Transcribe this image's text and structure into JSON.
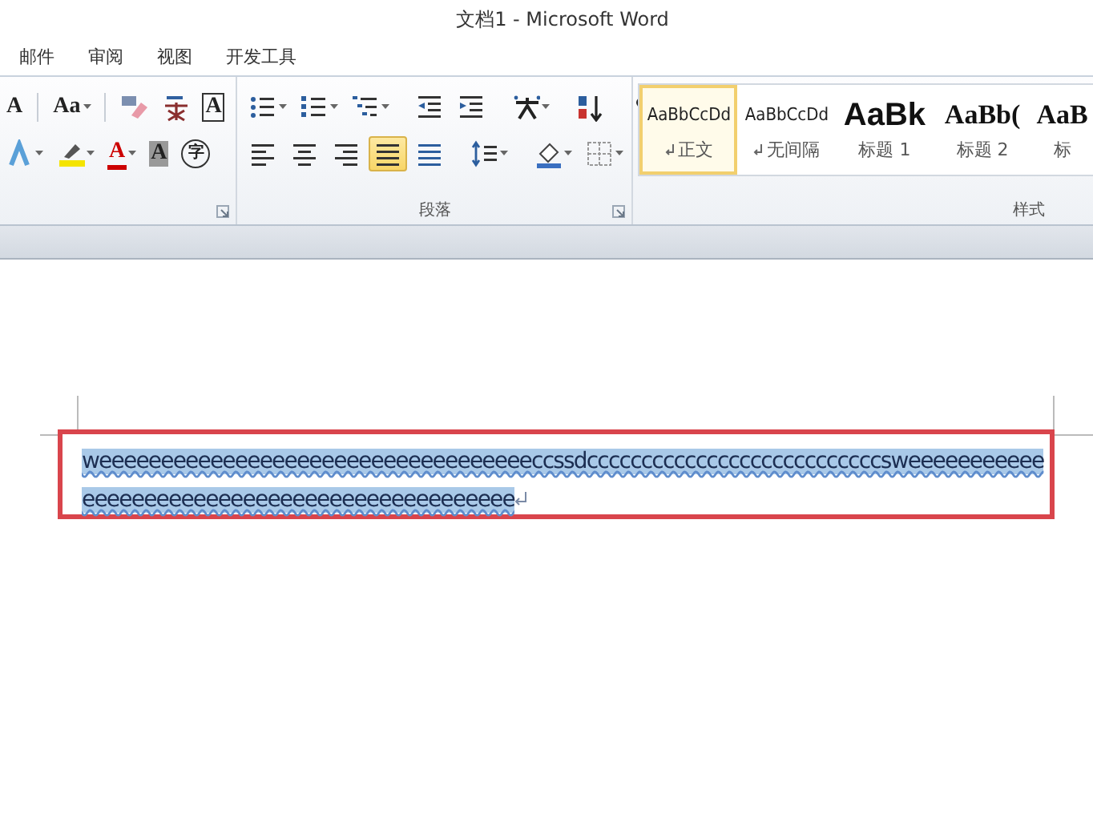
{
  "window": {
    "title": "文档1 - Microsoft Word"
  },
  "tabs": [
    {
      "label": "邮件",
      "selected": false
    },
    {
      "label": "审阅",
      "selected": false
    },
    {
      "label": "视图",
      "selected": false
    },
    {
      "label": "开发工具",
      "selected": false
    }
  ],
  "ribbon": {
    "groups": [
      {
        "kind": "font",
        "rows": [
          [
            {
              "kind": "grow-font",
              "label": "A"
            },
            {
              "kind": "sep"
            },
            {
              "kind": "text-drop",
              "label": "Aa"
            },
            {
              "kind": "sep"
            },
            {
              "kind": "clear-format"
            },
            {
              "kind": "phonetic"
            },
            {
              "kind": "boxed",
              "label": "A"
            }
          ],
          [
            {
              "kind": "effects"
            },
            {
              "kind": "highlight"
            },
            {
              "kind": "font-color",
              "label": "A"
            },
            {
              "kind": "shade",
              "label": "A"
            },
            {
              "kind": "enclosed",
              "label": "字"
            }
          ]
        ]
      },
      {
        "kind": "paragraph",
        "label": "段落",
        "rows": [
          [
            {
              "kind": "bullets"
            },
            {
              "kind": "numbering"
            },
            {
              "kind": "multilevel"
            },
            {
              "kind": "sep"
            },
            {
              "kind": "outdent"
            },
            {
              "kind": "indent"
            },
            {
              "kind": "sep"
            },
            {
              "kind": "asian"
            },
            {
              "kind": "sep"
            },
            {
              "kind": "sort"
            },
            {
              "kind": "sep"
            },
            {
              "kind": "marks"
            }
          ],
          [
            {
              "kind": "align-left",
              "selected": false
            },
            {
              "kind": "center",
              "selected": false
            },
            {
              "kind": "align-right",
              "selected": false
            },
            {
              "kind": "justify",
              "selected": true
            },
            {
              "kind": "distributed",
              "selected": false
            },
            {
              "kind": "sep"
            },
            {
              "kind": "spacing"
            },
            {
              "kind": "sep"
            },
            {
              "kind": "fill"
            },
            {
              "kind": "borders"
            }
          ]
        ]
      },
      {
        "kind": "styles",
        "label": "样式",
        "styles": [
          {
            "kind": "normal",
            "preview": "AaBbCcDd",
            "name": "正文",
            "selected": true
          },
          {
            "kind": "normal",
            "preview": "AaBbCcDd",
            "name": "无间隔",
            "selected": false
          },
          {
            "kind": "h1",
            "preview": "AaBk",
            "name": "标题 1",
            "selected": false
          },
          {
            "kind": "h2",
            "preview": "AaBb(",
            "name": "标题 2",
            "selected": false
          },
          {
            "kind": "h2",
            "preview": "AaB",
            "name": "标",
            "selected": false
          }
        ]
      }
    ]
  },
  "document": {
    "text": "weeeeeeeeeeeeeeeeeeeeeeeeeeeeeeeeeeeccssdcccccccccccccccccccccccccccsweeeeeeeeeeeeeeeeeeeeeeeeeeeeeeeeeeeeeeeeeeeeee",
    "selected": true,
    "highlighted": true
  }
}
